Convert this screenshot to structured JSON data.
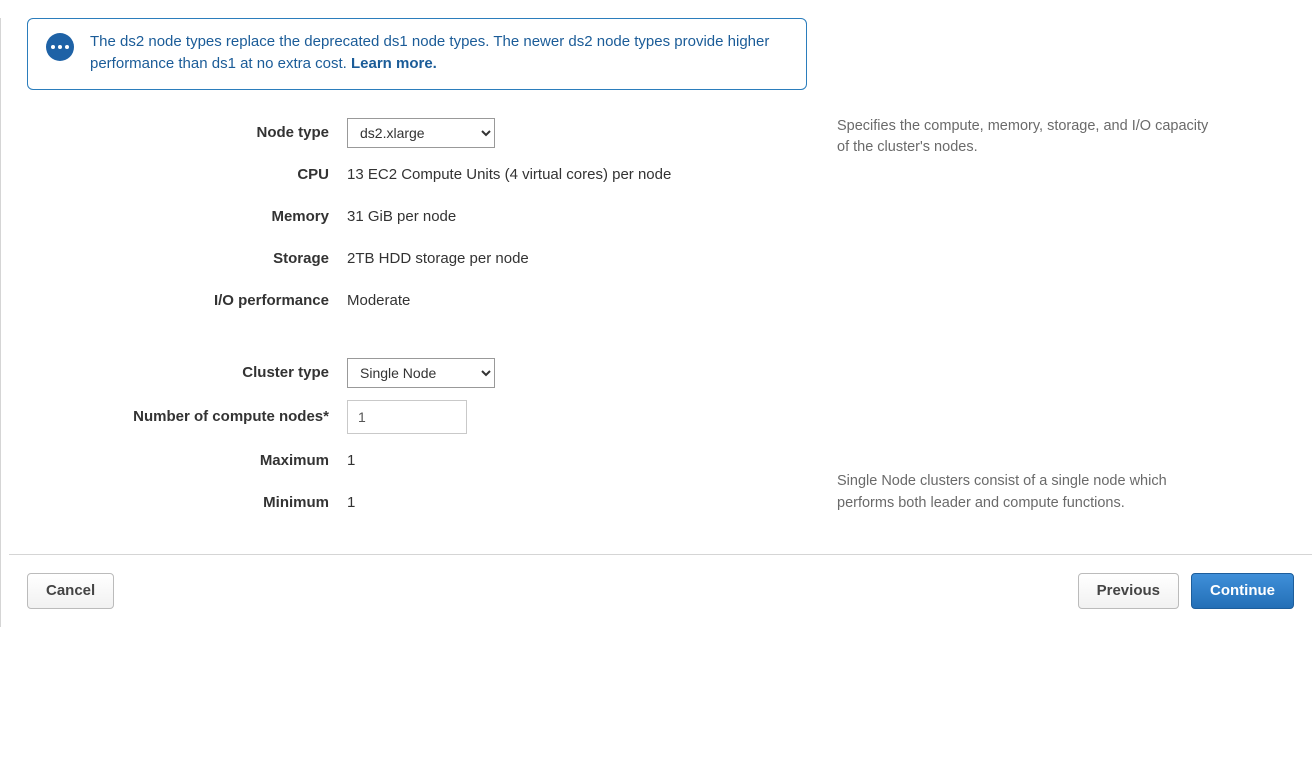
{
  "banner": {
    "text": "The ds2 node types replace the deprecated ds1 node types. The newer ds2 node types provide higher performance than ds1 at no extra cost. ",
    "link": "Learn more."
  },
  "labels": {
    "node_type": "Node type",
    "cpu": "CPU",
    "memory": "Memory",
    "storage": "Storage",
    "io_perf": "I/O performance",
    "cluster_type": "Cluster type",
    "num_nodes": "Number of compute nodes*",
    "maximum": "Maximum",
    "minimum": "Minimum"
  },
  "values": {
    "node_type_selected": "ds2.xlarge",
    "cpu": "13 EC2 Compute Units (4 virtual cores) per node",
    "memory": "31 GiB per node",
    "storage": "2TB HDD storage per node",
    "io_perf": "Moderate",
    "cluster_type_selected": "Single Node",
    "num_nodes": "1",
    "maximum": "1",
    "minimum": "1"
  },
  "help": {
    "node_type": "Specifies the compute, memory, storage, and I/O capacity of the cluster's nodes.",
    "cluster": "Single Node clusters consist of a single node which performs both leader and compute functions."
  },
  "buttons": {
    "cancel": "Cancel",
    "previous": "Previous",
    "continue": "Continue"
  }
}
